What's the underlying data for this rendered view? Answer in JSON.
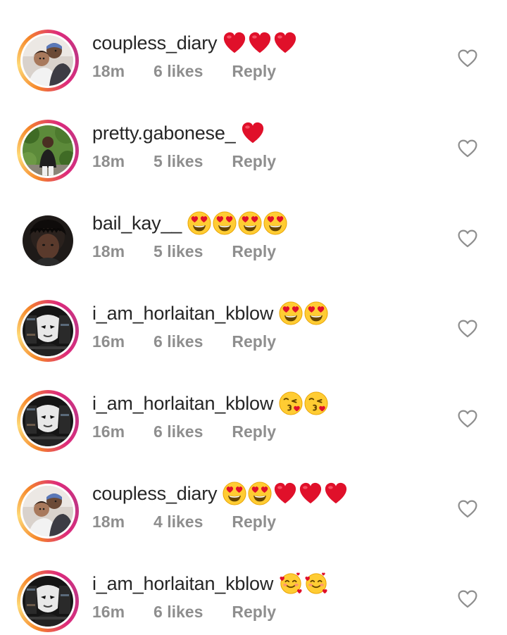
{
  "comments": [
    {
      "username": "coupless_diary",
      "time": "18m",
      "likes": "6 likes",
      "reply": "Reply",
      "avatar": "couple-photo",
      "story_ring": true,
      "emojis": [
        "red-heart",
        "red-heart",
        "red-heart"
      ]
    },
    {
      "username": "pretty.gabonese_",
      "time": "18m",
      "likes": "5 likes",
      "reply": "Reply",
      "avatar": "person-outdoors-photo",
      "story_ring": true,
      "emojis": [
        "red-heart"
      ]
    },
    {
      "username": "bail_kay__",
      "time": "18m",
      "likes": "5 likes",
      "reply": "Reply",
      "avatar": "dark-portrait-photo",
      "story_ring": false,
      "emojis": [
        "heart-eyes",
        "heart-eyes",
        "heart-eyes",
        "heart-eyes"
      ]
    },
    {
      "username": "i_am_horlaitan_kblow",
      "time": "16m",
      "likes": "6 likes",
      "reply": "Reply",
      "avatar": "masked-person-photo",
      "story_ring": true,
      "emojis": [
        "heart-eyes",
        "heart-eyes"
      ]
    },
    {
      "username": "i_am_horlaitan_kblow",
      "time": "16m",
      "likes": "6 likes",
      "reply": "Reply",
      "avatar": "masked-person-photo",
      "story_ring": true,
      "emojis": [
        "kissing-heart",
        "kissing-heart"
      ]
    },
    {
      "username": "coupless_diary",
      "time": "18m",
      "likes": "4 likes",
      "reply": "Reply",
      "avatar": "couple-photo",
      "story_ring": true,
      "emojis": [
        "heart-eyes",
        "heart-eyes",
        "red-heart",
        "red-heart",
        "red-heart"
      ]
    },
    {
      "username": "i_am_horlaitan_kblow",
      "time": "16m",
      "likes": "6 likes",
      "reply": "Reply",
      "avatar": "masked-person-photo",
      "story_ring": true,
      "emojis": [
        "smiling-hearts",
        "smiling-hearts"
      ]
    }
  ],
  "colors": {
    "username": "#262626",
    "meta": "#8e8e8e",
    "like_outline": "#8e8e8e",
    "heart_red": "#e0102a",
    "emoji_yellow": "#ffcc33"
  }
}
